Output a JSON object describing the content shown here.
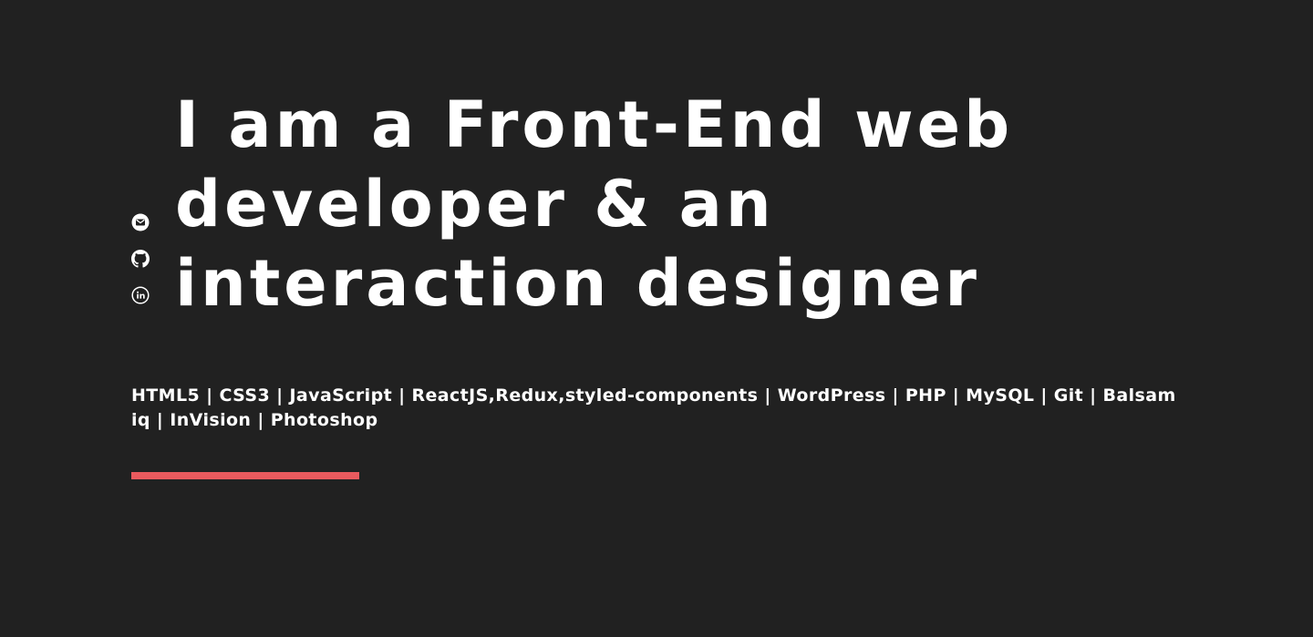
{
  "hero": {
    "headline": "I am a Front-End web developer & an interaction designer",
    "skills": "HTML5 | CSS3 | JavaScript | ReactJS,Redux,styled-components | WordPress | PHP | MySQL | Git | Balsamiq | InVision | Photoshop"
  },
  "social_links": [
    {
      "icon": "envelope-icon"
    },
    {
      "icon": "github-icon"
    },
    {
      "icon": "linkedin-icon"
    }
  ],
  "colors": {
    "background": "#212121",
    "text": "#ffffff",
    "accent": "#ea5a5e"
  }
}
